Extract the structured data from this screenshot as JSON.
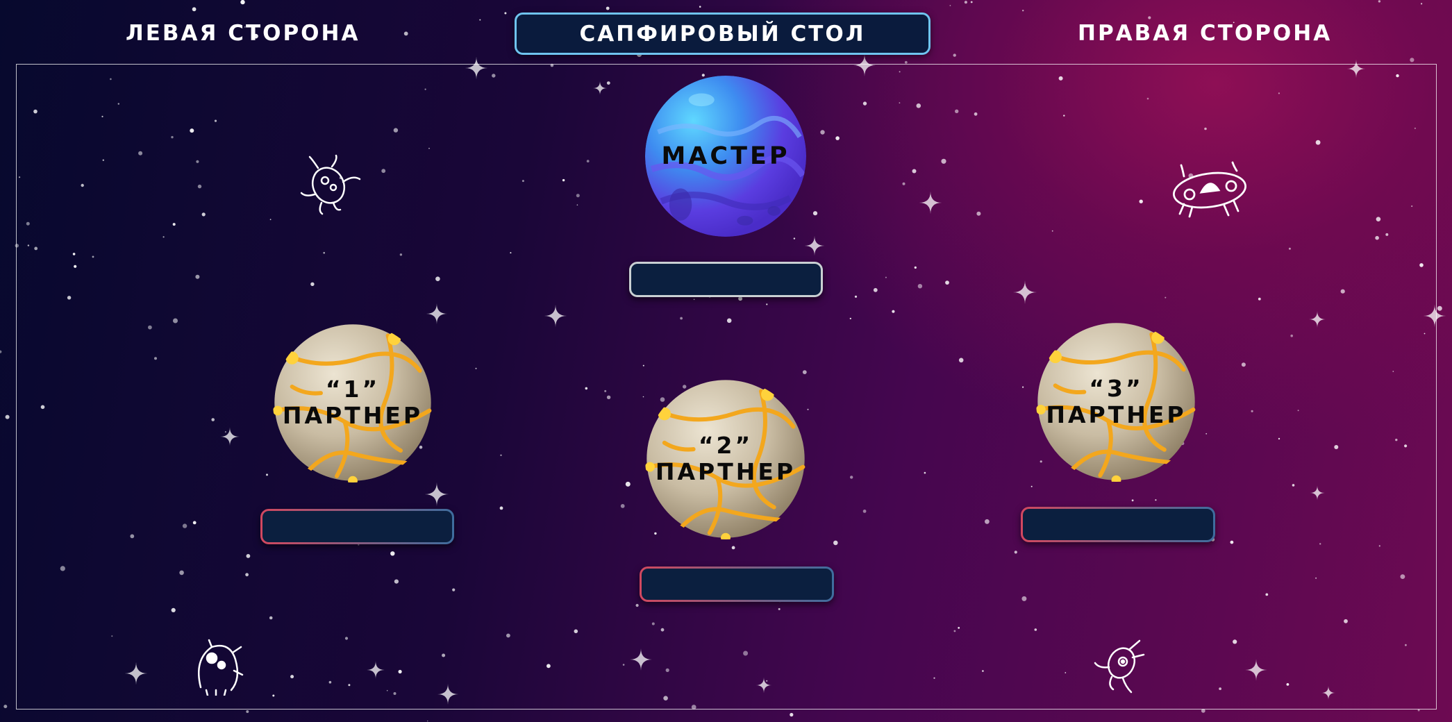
{
  "header": {
    "left_title": "ЛЕВАЯ СТОРОНА",
    "center_title": "САПФИРОВЫЙ СТОЛ",
    "right_title": "ПРАВАЯ СТОРОНА"
  },
  "planets": {
    "master": {
      "label": "МАСТЕР",
      "style": "blue-planet-icon"
    },
    "partner1": {
      "number": "“1”",
      "label": "ПАРТНЕР",
      "style": "lava-planet-icon"
    },
    "partner2": {
      "number": "“2”",
      "label": "ПАРТНЕР",
      "style": "lava-planet-icon"
    },
    "partner3": {
      "number": "“3”",
      "label": "ПАРТНЕР",
      "style": "lava-planet-icon"
    }
  },
  "name_boxes": {
    "master": "",
    "partner1": "",
    "partner2": "",
    "partner3": ""
  },
  "decor": [
    "alien-doodle-icon",
    "ufo-doodle-icon",
    "monster-doodle-icon",
    "alien-doodle-icon"
  ],
  "colors": {
    "background_dark": "#07092e",
    "background_magenta": "#8e0f55",
    "title_border": "#6fc4ef",
    "box_fill": "#0b1f3f",
    "box_border_red": "#d2485f",
    "box_border_blue": "#3e6d9e",
    "master_box_border": "#c9d0d3"
  }
}
